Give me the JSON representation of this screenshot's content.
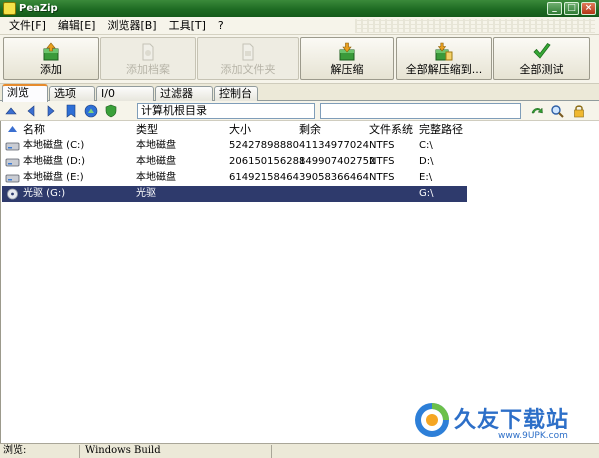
{
  "window": {
    "title": "PeaZip"
  },
  "menu": [
    "文件[F]",
    "编辑[E]",
    "浏览器[B]",
    "工具[T]",
    "?"
  ],
  "toolbar": {
    "add": "添加",
    "add_file": "添加档案",
    "add_folder": "添加文件夹",
    "extract": "解压缩",
    "extract_all": "全部解压缩到...",
    "test_all": "全部测试"
  },
  "tabs": [
    "浏览",
    "选项",
    "I/0",
    "过滤器",
    "控制台"
  ],
  "nav": {
    "path": "计算机根目录",
    "filter": ""
  },
  "columns": {
    "name": "名称",
    "type": "类型",
    "size": "大小",
    "free": "剩余",
    "fs": "文件系统",
    "full_path": "完整路径"
  },
  "rows": [
    {
      "name": "本地磁盘 (C:)",
      "type": "本地磁盘",
      "size": "52427898880",
      "free": "41134977024",
      "fs": "NTFS",
      "path": "C:\\",
      "icon": "hard-drive-icon"
    },
    {
      "name": "本地磁盘 (D:)",
      "type": "本地磁盘",
      "size": "206150156288",
      "free": "149907402752",
      "fs": "NTFS",
      "path": "D:\\",
      "icon": "hard-drive-icon"
    },
    {
      "name": "本地磁盘 (E:)",
      "type": "本地磁盘",
      "size": "61492158464",
      "free": "39058366464",
      "fs": "NTFS",
      "path": "E:\\",
      "icon": "hard-drive-icon"
    },
    {
      "name": "光驱 (G:)",
      "type": "光驱",
      "size": "",
      "free": "",
      "fs": "",
      "path": "G:\\",
      "icon": "cd-drive-icon",
      "selected": true
    }
  ],
  "status": {
    "left": "浏览:",
    "build": "Windows Build"
  },
  "watermark": {
    "name": "久友下载站",
    "url": "www.9UPK.com"
  },
  "colors": {
    "title_green": "#1e6b23",
    "selection": "#2e3a6c",
    "add_green": "#3a9a3a"
  }
}
